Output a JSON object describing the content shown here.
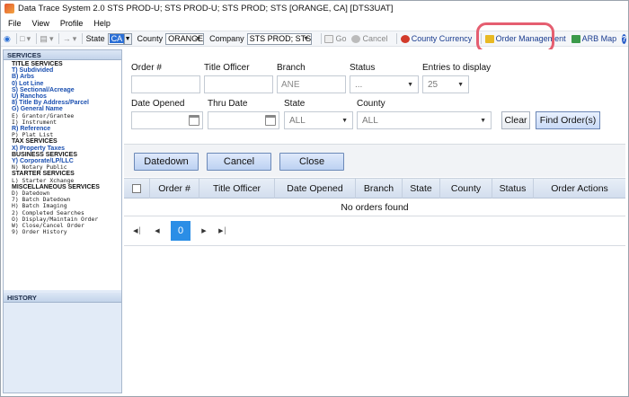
{
  "window": {
    "title": "Data Trace System 2.0 STS PROD-U; STS PROD-U; STS PROD; STS [ORANGE, CA] [DTS3UAT]"
  },
  "menu": [
    "File",
    "View",
    "Profile",
    "Help"
  ],
  "toolbar": {
    "state_label": "State",
    "state_value": "CA",
    "county_label": "County",
    "county_value": "ORANGE",
    "company_label": "Company",
    "company_value": "STS PROD; STS",
    "go_label": "Go",
    "cancel_label": "Cancel",
    "county_currency_label": "County Currency",
    "order_management_label": "Order Management",
    "arb_map_label": "ARB Map"
  },
  "sidebar": {
    "services_header": "SERVICES",
    "history_header": "HISTORY",
    "lines": [
      {
        "text": "TITLE SERVICES",
        "kind": "hdr"
      },
      {
        "text": "T) Subdivided",
        "kind": "link"
      },
      {
        "text": "B) Arbs",
        "kind": "link"
      },
      {
        "text": "0) Lot Line",
        "kind": "link"
      },
      {
        "text": "S) Sectional/Acreage",
        "kind": "link"
      },
      {
        "text": "U) Ranchos",
        "kind": "link"
      },
      {
        "text": "8) Title By Address/Parcel",
        "kind": "link"
      },
      {
        "text": "G) General Name",
        "kind": "link"
      },
      {
        "text": "E) Grantor/Grantee",
        "kind": "mono"
      },
      {
        "text": "I) Instrument",
        "kind": "mono"
      },
      {
        "text": "R) Reference",
        "kind": "link"
      },
      {
        "text": "P) Plat List",
        "kind": "mono"
      },
      {
        "text": "TAX SERVICES",
        "kind": "hdr"
      },
      {
        "text": "X) Property Taxes",
        "kind": "link"
      },
      {
        "text": "BUSINESS SERVICES",
        "kind": "hdr"
      },
      {
        "text": "Y) Corporate/LP/LLC",
        "kind": "link"
      },
      {
        "text": "N) Notary Public",
        "kind": "mono"
      },
      {
        "text": "STARTER SERVICES",
        "kind": "hdr"
      },
      {
        "text": "L) Starter Xchange",
        "kind": "mono"
      },
      {
        "text": "MISCELLANEOUS SERVICES",
        "kind": "hdr"
      },
      {
        "text": "D) Datedown",
        "kind": "mono"
      },
      {
        "text": "7) Batch Datedown",
        "kind": "mono"
      },
      {
        "text": "H) Batch Imaging",
        "kind": "mono"
      },
      {
        "text": "2) Completed Searches",
        "kind": "mono"
      },
      {
        "text": "O) Display/Maintain Order",
        "kind": "mono"
      },
      {
        "text": "W) Close/Cancel Order",
        "kind": "mono"
      },
      {
        "text": "9) Order History",
        "kind": "mono"
      }
    ]
  },
  "filters": {
    "order_label": "Order #",
    "title_officer_label": "Title Officer",
    "branch_label": "Branch",
    "branch_value": "ANE",
    "status_label": "Status",
    "status_value": "...",
    "entries_label": "Entries to display",
    "entries_value": "25",
    "date_opened_label": "Date Opened",
    "thru_date_label": "Thru Date",
    "state_label": "State",
    "state_value": "ALL",
    "county_label": "County",
    "county_value": "ALL",
    "clear_label": "Clear",
    "find_label": "Find Order(s)"
  },
  "actions": {
    "datedown_label": "Datedown",
    "cancel_label": "Cancel",
    "close_label": "Close"
  },
  "grid": {
    "columns": [
      "Order #",
      "Title Officer",
      "Date Opened",
      "Branch",
      "State",
      "County",
      "Status",
      "Order Actions"
    ],
    "empty_message": "No orders found",
    "current_page": "0"
  }
}
